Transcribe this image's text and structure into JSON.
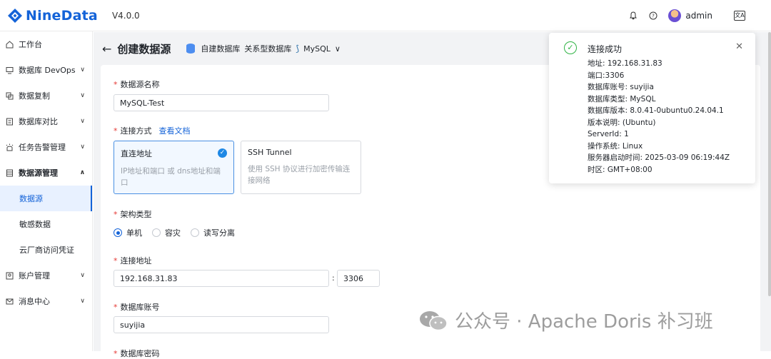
{
  "brand": {
    "name": "NineData",
    "version": "V4.0.0"
  },
  "topbar": {
    "user": "admin",
    "lang_label": "文A"
  },
  "sidebar": {
    "items": [
      {
        "label": "工作台"
      },
      {
        "label": "数据库 DevOps"
      },
      {
        "label": "数据复制"
      },
      {
        "label": "数据库对比"
      },
      {
        "label": "任务告警管理"
      },
      {
        "label": "数据源管理"
      },
      {
        "label": "数据源"
      },
      {
        "label": "敏感数据"
      },
      {
        "label": "云厂商访问凭证"
      },
      {
        "label": "账户管理"
      },
      {
        "label": "消息中心"
      }
    ]
  },
  "header": {
    "title": "创建数据源",
    "crumb_self_built": "自建数据库",
    "crumb_relational": "关系型数据库",
    "crumb_engine": "MySQL"
  },
  "form": {
    "name_label": "数据源名称",
    "name_value": "MySQL-Test",
    "conn_method_label": "连接方式",
    "doc_link": "查看文档",
    "direct_title": "直连地址",
    "direct_desc": "IP地址和端口 或 dns地址和端口",
    "ssh_title": "SSH Tunnel",
    "ssh_desc": "使用 SSH 协议进行加密传输连接网络",
    "arch_label": "架构类型",
    "arch_single": "单机",
    "arch_dr": "容灾",
    "arch_rw": "读写分离",
    "addr_label": "连接地址",
    "addr_host": "192.168.31.83",
    "addr_port": "3306",
    "account_label": "数据库账号",
    "account_value": "suyijia",
    "password_label": "数据库密码"
  },
  "notification": {
    "title": "连接成功",
    "lines": [
      "地址: 192.168.31.83",
      "端口:3306",
      "数据库账号: suyijia",
      "数据库类型: MySQL",
      "数据库版本: 8.0.41-0ubuntu0.24.04.1",
      "版本说明: (Ubuntu)",
      "ServerId: 1",
      "操作系统: Linux",
      "服务器启动时间: 2025-03-09 06:19:44Z",
      "时区: GMT+08:00"
    ]
  },
  "watermark": {
    "text": "公众号 · Apache Doris 补习班"
  },
  "colors": {
    "primary": "#1463d8",
    "success": "#2fb344",
    "required": "#e53935"
  }
}
